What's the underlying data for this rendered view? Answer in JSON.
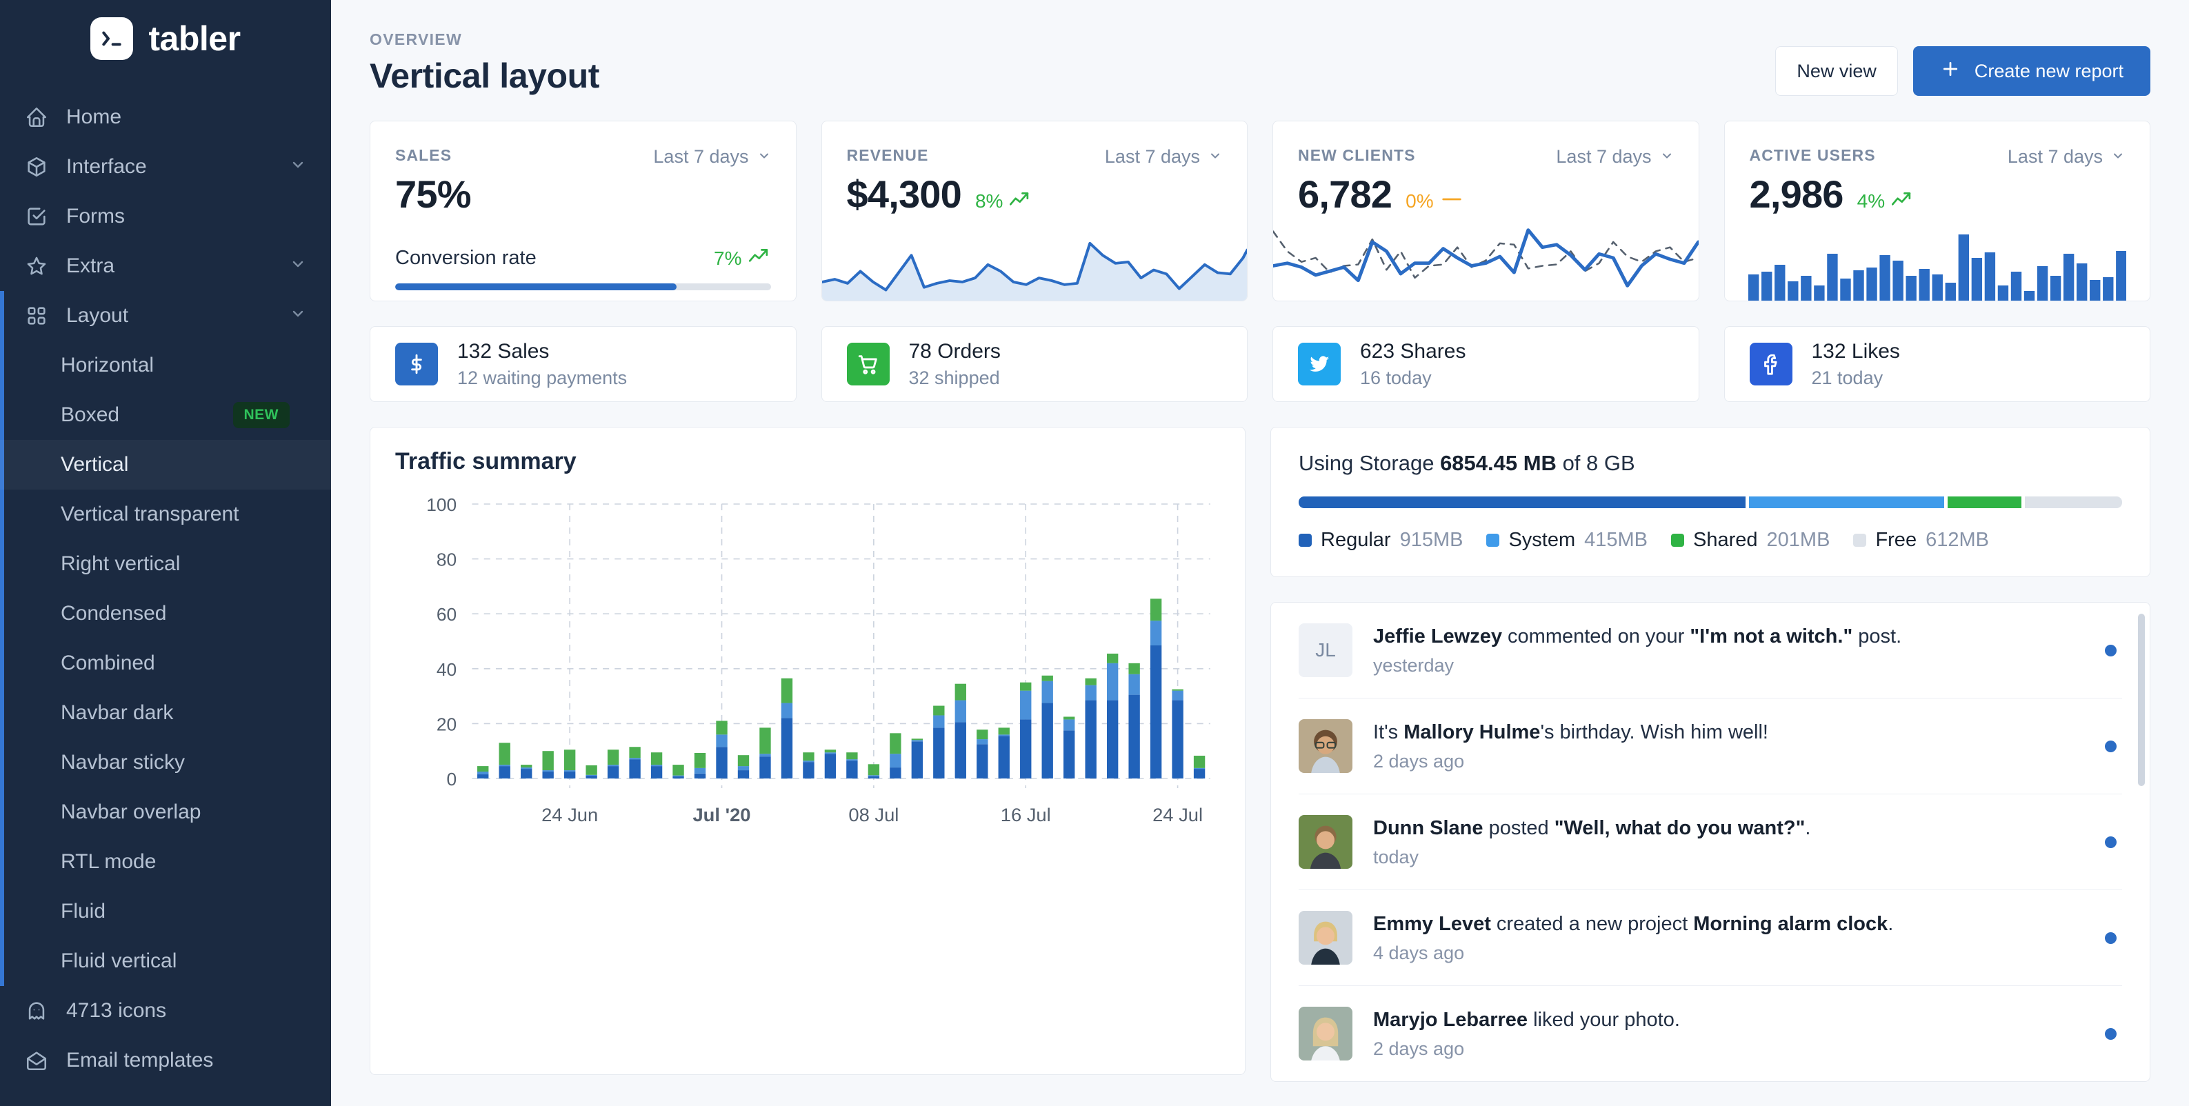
{
  "brand": {
    "name": "tabler",
    "logo_icon": "terminal-icon"
  },
  "sidebar": {
    "items": [
      {
        "label": "Home",
        "icon": "home-icon",
        "chevron": false
      },
      {
        "label": "Interface",
        "icon": "package-icon",
        "chevron": true
      },
      {
        "label": "Forms",
        "icon": "checkbox-icon",
        "chevron": false
      },
      {
        "label": "Extra",
        "icon": "star-icon",
        "chevron": true
      },
      {
        "label": "Layout",
        "icon": "layout-grid-icon",
        "chevron": true
      }
    ],
    "layout_children": [
      {
        "label": "Horizontal",
        "badge": "",
        "selected": false
      },
      {
        "label": "Boxed",
        "badge": "NEW",
        "selected": false
      },
      {
        "label": "Vertical",
        "badge": "",
        "selected": true
      },
      {
        "label": "Vertical transparent",
        "badge": "",
        "selected": false
      },
      {
        "label": "Right vertical",
        "badge": "",
        "selected": false
      },
      {
        "label": "Condensed",
        "badge": "",
        "selected": false
      },
      {
        "label": "Combined",
        "badge": "",
        "selected": false
      },
      {
        "label": "Navbar dark",
        "badge": "",
        "selected": false
      },
      {
        "label": "Navbar sticky",
        "badge": "",
        "selected": false
      },
      {
        "label": "Navbar overlap",
        "badge": "",
        "selected": false
      },
      {
        "label": "RTL mode",
        "badge": "",
        "selected": false
      },
      {
        "label": "Fluid",
        "badge": "",
        "selected": false
      },
      {
        "label": "Fluid vertical",
        "badge": "",
        "selected": false
      }
    ],
    "bottom_items": [
      {
        "label": "4713 icons",
        "icon": "ghost-icon"
      },
      {
        "label": "Email templates",
        "icon": "mail-open-icon"
      }
    ]
  },
  "header": {
    "pretitle": "Overview",
    "title": "Vertical layout",
    "new_view_label": "New view",
    "create_report_label": "Create new report",
    "plus_icon": "plus-icon"
  },
  "stat_cards": [
    {
      "label": "Sales",
      "value": "75%",
      "period": "Last 7 days",
      "delta": "",
      "delta_dir": "",
      "conversion_label": "Conversion rate",
      "conversion_delta": "7%",
      "progress_percent": 75,
      "chart_kind": "progress"
    },
    {
      "label": "Revenue",
      "value": "$4,300",
      "period": "Last 7 days",
      "delta": "8%",
      "delta_dir": "up",
      "chart_kind": "area"
    },
    {
      "label": "New clients",
      "value": "6,782",
      "period": "Last 7 days",
      "delta": "0%",
      "delta_dir": "flat",
      "chart_kind": "line-dashed"
    },
    {
      "label": "Active users",
      "value": "2,986",
      "period": "Last 7 days",
      "delta": "4%",
      "delta_dir": "up",
      "chart_kind": "bars"
    }
  ],
  "mini_cards": [
    {
      "icon": "dollar-icon",
      "color": "#2b6cc4",
      "title": "132 Sales",
      "sub": "12 waiting payments"
    },
    {
      "icon": "shopping-cart-icon",
      "color": "#2fb344",
      "title": "78 Orders",
      "sub": "32 shipped"
    },
    {
      "icon": "twitter-icon",
      "color": "#21a7ee",
      "title": "623 Shares",
      "sub": "16 today"
    },
    {
      "icon": "facebook-icon",
      "color": "#2b5fd9",
      "title": "132 Likes",
      "sub": "21 today"
    }
  ],
  "storage": {
    "prefix": "Using Storage ",
    "used": "6854.45 MB",
    "suffix": " of 8 GB",
    "segments": [
      {
        "name": "Regular",
        "value": "915MB",
        "color": "#2162b9",
        "percent": 55
      },
      {
        "name": "System",
        "value": "415MB",
        "color": "#3f9bea",
        "percent": 24
      },
      {
        "name": "Shared",
        "value": "201MB",
        "color": "#2fb344",
        "percent": 9
      },
      {
        "name": "Free",
        "value": "612MB",
        "color": "#dde2e9",
        "percent": 12
      }
    ]
  },
  "feed": [
    {
      "avatar_type": "initials",
      "initials": "JL",
      "prefix": "",
      "name": "Jeffie Lewzey",
      "mid": " commented on your ",
      "quote": "\"I'm not a witch.\"",
      "suffix": " post.",
      "time": "yesterday",
      "unread": true
    },
    {
      "avatar_type": "photo",
      "photo": "man-glasses",
      "prefix": "It's ",
      "name": "Mallory Hulme",
      "mid": "'s birthday. Wish him well!",
      "quote": "",
      "suffix": "",
      "time": "2 days ago",
      "unread": true
    },
    {
      "avatar_type": "photo",
      "photo": "man-outdoor",
      "prefix": "",
      "name": "Dunn Slane",
      "mid": " posted ",
      "quote": "\"Well, what do you want?\"",
      "suffix": ".",
      "time": "today",
      "unread": true
    },
    {
      "avatar_type": "photo",
      "photo": "woman-blonde",
      "prefix": "",
      "name": "Emmy Levet",
      "mid": " created a new project ",
      "quote": "Morning alarm clock",
      "suffix": ".",
      "time": "4 days ago",
      "unread": true
    },
    {
      "avatar_type": "photo",
      "photo": "woman-long-hair",
      "prefix": "",
      "name": "Maryjo Lebarree",
      "mid": " liked your photo.",
      "quote": "",
      "suffix": "",
      "time": "2 days ago",
      "unread": true
    }
  ],
  "chart_data": {
    "type": "bar",
    "stacked": true,
    "title": "Traffic summary",
    "xlabel": "",
    "ylabel": "",
    "ylim": [
      0,
      100
    ],
    "yticks": [
      0,
      20,
      40,
      60,
      80,
      100
    ],
    "grid": true,
    "legend": "none",
    "xtick_labels": [
      "24 Jun",
      "Jul '20",
      "08 Jul",
      "16 Jul",
      "24 Jul"
    ],
    "xtick_indices": [
      4,
      11,
      18,
      25,
      32
    ],
    "series": [
      {
        "name": "Series A",
        "color": "#2162b9",
        "values": [
          1.5,
          4.5,
          3.5,
          2.5,
          2.5,
          1.0,
          4.5,
          7.0,
          4.5,
          0.8,
          1.8,
          11.5,
          3.0,
          8.0,
          22.0,
          6.0,
          9.0,
          6.5,
          0.8,
          4.0,
          13.5,
          18.5,
          20.5,
          12.5,
          15.5,
          21.5,
          27.5,
          17.5,
          28.5,
          28.5,
          30.5,
          48.5,
          28.5,
          3.5
        ]
      },
      {
        "name": "Series B",
        "color": "#4a90d9",
        "values": [
          1.0,
          0.5,
          0.5,
          0.5,
          0.5,
          0.3,
          0.5,
          0.5,
          0.5,
          0.3,
          2.0,
          4.5,
          1.5,
          1.0,
          5.5,
          0.5,
          0.5,
          0.5,
          0.4,
          5.0,
          0.5,
          4.5,
          8.0,
          1.8,
          0.5,
          10.5,
          8.0,
          4.0,
          5.5,
          13.5,
          7.5,
          9.0,
          3.5,
          0.3
        ]
      },
      {
        "name": "Series C",
        "color": "#4caf50",
        "values": [
          2.0,
          8.0,
          1.0,
          7.0,
          7.5,
          3.5,
          5.5,
          4.0,
          4.5,
          3.9,
          5.5,
          5.0,
          4.0,
          9.5,
          9.0,
          3.0,
          1.0,
          2.5,
          4.0,
          7.5,
          0.5,
          3.5,
          6.0,
          3.5,
          2.5,
          3.0,
          2.0,
          1.0,
          2.5,
          3.5,
          4.0,
          8.0,
          0.5,
          4.5
        ]
      }
    ]
  }
}
